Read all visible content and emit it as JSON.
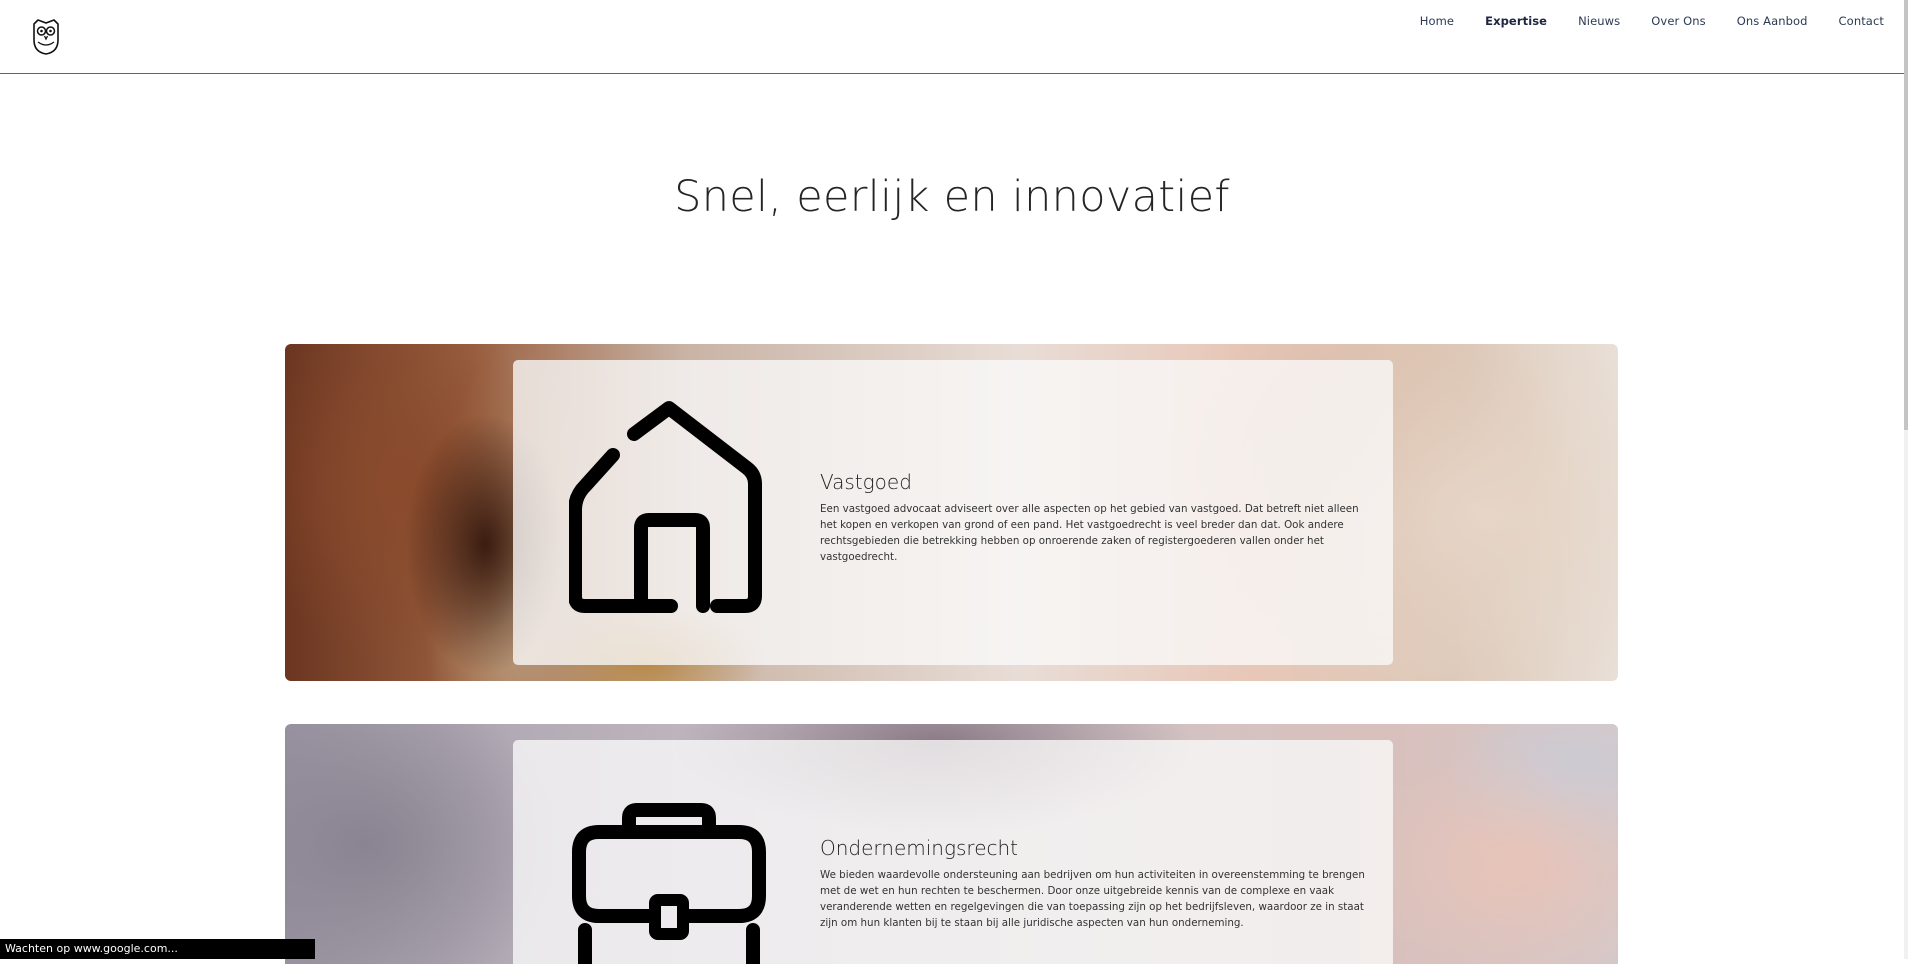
{
  "header": {
    "logo_icon": "owl-logo-icon",
    "nav": [
      {
        "label": "Home",
        "active": false
      },
      {
        "label": "Expertise",
        "active": true
      },
      {
        "label": "Nieuws",
        "active": false
      },
      {
        "label": "Over Ons",
        "active": false
      },
      {
        "label": "Ons Aanbod",
        "active": false
      },
      {
        "label": "Contact",
        "active": false
      }
    ]
  },
  "hero": {
    "title": "Snel, eerlijk en innovatief"
  },
  "cards": [
    {
      "icon": "house-icon",
      "title": "Vastgoed",
      "description": "Een vastgoed advocaat adviseert over alle aspecten op het gebied van vastgoed. Dat betreft niet alleen het kopen en verkopen van grond of een pand. Het vastgoedrecht is veel breder dan dat. Ook andere rechtsgebieden die betrekking hebben op onroerende zaken of registergoederen vallen onder het vastgoedrecht."
    },
    {
      "icon": "briefcase-icon",
      "title": "Ondernemingsrecht",
      "description": "We bieden waardevolle ondersteuning aan bedrijven om hun activiteiten in overeenstemming te brengen met de wet en hun rechten te beschermen. Door onze uitgebreide kennis van de complexe en vaak veranderende wetten en regelgevingen die van toepassing zijn op het bedrijfsleven, waardoor ze in staat zijn om hun klanten bij te staan bij alle juridische aspecten van hun onderneming."
    }
  ],
  "status_bar": {
    "text": "Wachten op www.google.com..."
  },
  "colors": {
    "nav_text": "#2c3a55",
    "header_border": "#666666",
    "card_overlay": "rgba(250,250,250,0.78)"
  }
}
